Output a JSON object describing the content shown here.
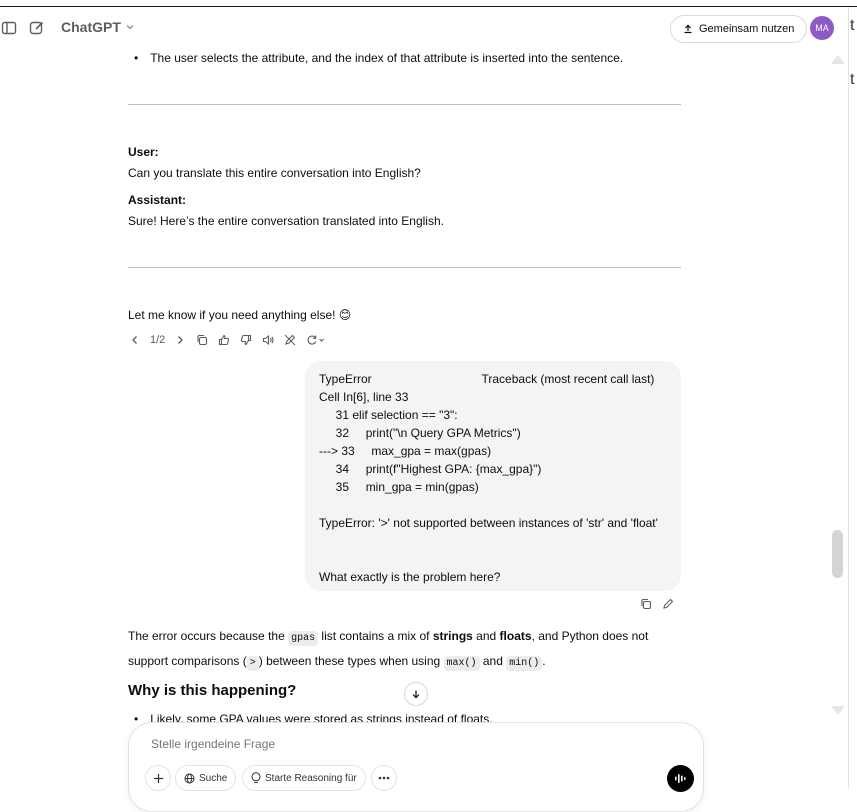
{
  "header": {
    "model_name": "ChatGPT",
    "share_label": "Gemeinsam nutzen",
    "avatar_initials": "MA"
  },
  "right_panel_glyphs": [
    "t",
    "t"
  ],
  "conversation": {
    "bullet_top": "The user selects the attribute, and the index of that attribute is inserted into the sentence.",
    "user_label": "User:",
    "user_text": "Can you translate this entire conversation into English?",
    "assistant_label": "Assistant:",
    "assistant_text": "Sure! Here’s the entire conversation translated into English.",
    "closing_text": "Let me know if you need anything else! 😊",
    "pager": "1/2"
  },
  "user_message": {
    "lines": [
      "TypeError                                 Traceback (most recent call last)",
      "Cell In[6], line 33",
      "     31 elif selection == \"3\":",
      "     32     print(\"\\n Query GPA Metrics\")",
      "---> 33     max_gpa = max(gpas)",
      "     34     print(f\"Highest GPA: {max_gpa}\")",
      "     35     min_gpa = min(gpas)",
      "",
      "TypeError: '>' not supported between instances of 'str' and 'float'",
      "",
      "",
      "What exactly is the problem here?"
    ]
  },
  "answer": {
    "p1_a": "The error occurs because the ",
    "p1_code1": "gpas",
    "p1_b": " list contains a mix of ",
    "p1_strong1": "strings",
    "p1_c": " and ",
    "p1_strong2": "floats",
    "p1_d": ", and Python does not support comparisons (",
    "p1_code2": ">",
    "p1_e": ") between these types when using ",
    "p1_code3": "max()",
    "p1_f": " and ",
    "p1_code4": "min()",
    "p1_g": ".",
    "heading": "Why is this happening?",
    "peek_bullet": "Likely, some GPA values were stored as strings instead of floats."
  },
  "composer": {
    "placeholder": "Stelle irgendeine Frage",
    "search_label": "Suche",
    "reason_label": "Starte Reasoning für"
  }
}
